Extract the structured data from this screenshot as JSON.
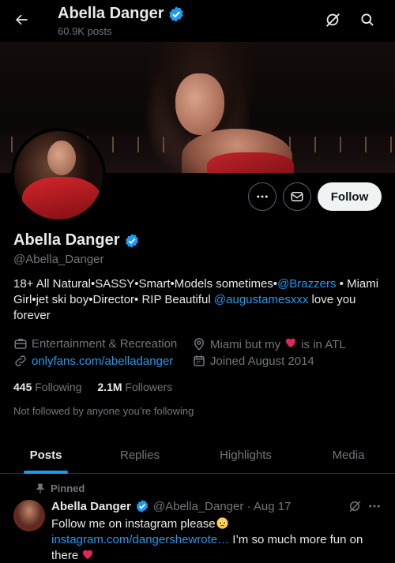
{
  "header": {
    "name": "Abella Danger",
    "posts": "60.9K posts"
  },
  "profile": {
    "name": "Abella Danger",
    "handle": "@Abella_Danger",
    "follow_label": "Follow",
    "bio": {
      "part1": "18+ All Natural•SASSY•Smart•Models sometimes•",
      "mention1": "@Brazzers",
      "part2": " • Miami Girl•jet ski boy•Director• RIP Beautiful ",
      "mention2": "@augustamesxxx",
      "part3": " love you forever"
    },
    "category": "Entertainment & Recreation",
    "location_prefix": "Miami but my",
    "location_suffix": "is in ATL",
    "website": "onlyfans.com/abelladanger",
    "joined": "Joined August 2014",
    "following_count": "445",
    "following_label": "Following",
    "followers_count": "2.1M",
    "followers_label": "Followers",
    "not_followed": "Not followed by anyone you’re following"
  },
  "tabs": [
    "Posts",
    "Replies",
    "Highlights",
    "Media"
  ],
  "post": {
    "pinned_label": "Pinned",
    "name": "Abella Danger",
    "handle_date": "@Abella_Danger · Aug 17",
    "line1": "Follow me on instagram please",
    "link": "instagram.com/dangershewrote…",
    "line2": " I’m so much more fun on there"
  },
  "colors": {
    "accent": "#1d9bf0",
    "heart": "#f91880",
    "verified": "#1d9bf0"
  }
}
